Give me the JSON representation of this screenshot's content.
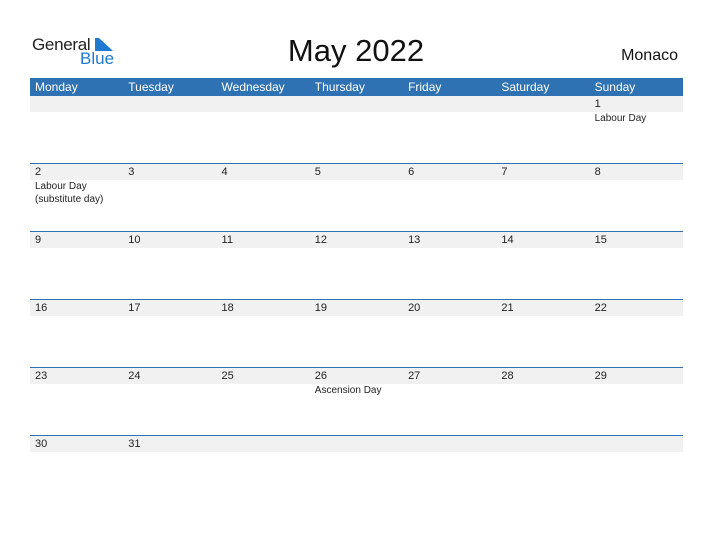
{
  "logo": {
    "general": "General",
    "blue": "Blue"
  },
  "title": "May 2022",
  "country": "Monaco",
  "weekdays": [
    "Monday",
    "Tuesday",
    "Wednesday",
    "Thursday",
    "Friday",
    "Saturday",
    "Sunday"
  ],
  "weeks": [
    [
      {
        "d": ""
      },
      {
        "d": ""
      },
      {
        "d": ""
      },
      {
        "d": ""
      },
      {
        "d": ""
      },
      {
        "d": ""
      },
      {
        "d": "1",
        "h": "Labour Day"
      }
    ],
    [
      {
        "d": "2",
        "h": "Labour Day (substitute day)"
      },
      {
        "d": "3"
      },
      {
        "d": "4"
      },
      {
        "d": "5"
      },
      {
        "d": "6"
      },
      {
        "d": "7"
      },
      {
        "d": "8"
      }
    ],
    [
      {
        "d": "9"
      },
      {
        "d": "10"
      },
      {
        "d": "11"
      },
      {
        "d": "12"
      },
      {
        "d": "13"
      },
      {
        "d": "14"
      },
      {
        "d": "15"
      }
    ],
    [
      {
        "d": "16"
      },
      {
        "d": "17"
      },
      {
        "d": "18"
      },
      {
        "d": "19"
      },
      {
        "d": "20"
      },
      {
        "d": "21"
      },
      {
        "d": "22"
      }
    ],
    [
      {
        "d": "23"
      },
      {
        "d": "24"
      },
      {
        "d": "25"
      },
      {
        "d": "26",
        "h": "Ascension Day"
      },
      {
        "d": "27"
      },
      {
        "d": "28"
      },
      {
        "d": "29"
      }
    ],
    [
      {
        "d": "30"
      },
      {
        "d": "31"
      },
      {
        "d": ""
      },
      {
        "d": ""
      },
      {
        "d": ""
      },
      {
        "d": ""
      },
      {
        "d": ""
      }
    ]
  ],
  "colors": {
    "header": "#2f72b3",
    "brand_blue": "#1f7ad0",
    "strip": "#f1f1f1"
  }
}
